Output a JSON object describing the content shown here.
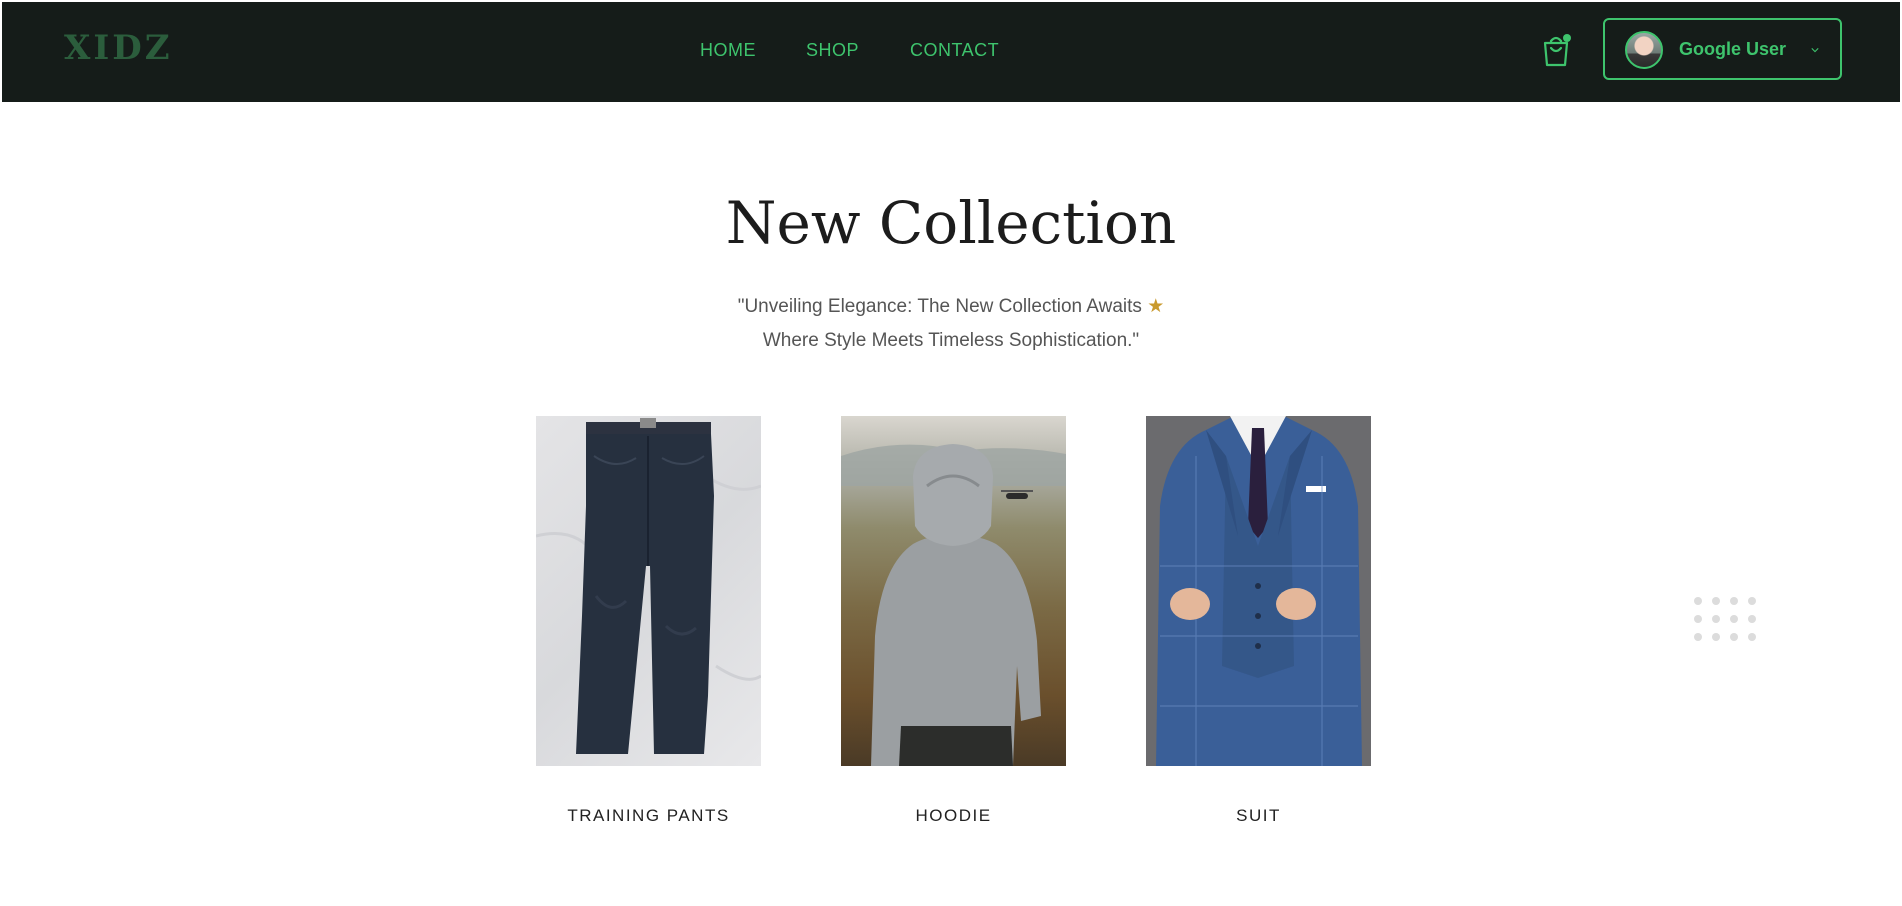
{
  "brand": {
    "logo_text": "XIDZ",
    "accent_color": "#3ec46d",
    "nav_background": "#151c19"
  },
  "nav": {
    "links": [
      {
        "label": "HOME"
      },
      {
        "label": "SHOP"
      },
      {
        "label": "CONTACT"
      }
    ],
    "cart_icon": "shopping-bag-icon",
    "user": {
      "name": "Google User",
      "avatar_icon": "avatar",
      "dropdown_icon": "chevron-down-icon"
    }
  },
  "hero": {
    "title": "New Collection",
    "tagline_line1": "\"Unveiling Elegance: The New Collection Awaits",
    "tagline_star": "★",
    "tagline_line2": "Where Style Meets Timeless Sophistication.\""
  },
  "products": [
    {
      "name": "TRAINING PANTS",
      "image": "jeans-photo"
    },
    {
      "name": "HOODIE",
      "image": "hoodie-photo"
    },
    {
      "name": "SUIT",
      "image": "suit-photo"
    }
  ],
  "decor": {
    "icon": "dot-grid-icon"
  }
}
